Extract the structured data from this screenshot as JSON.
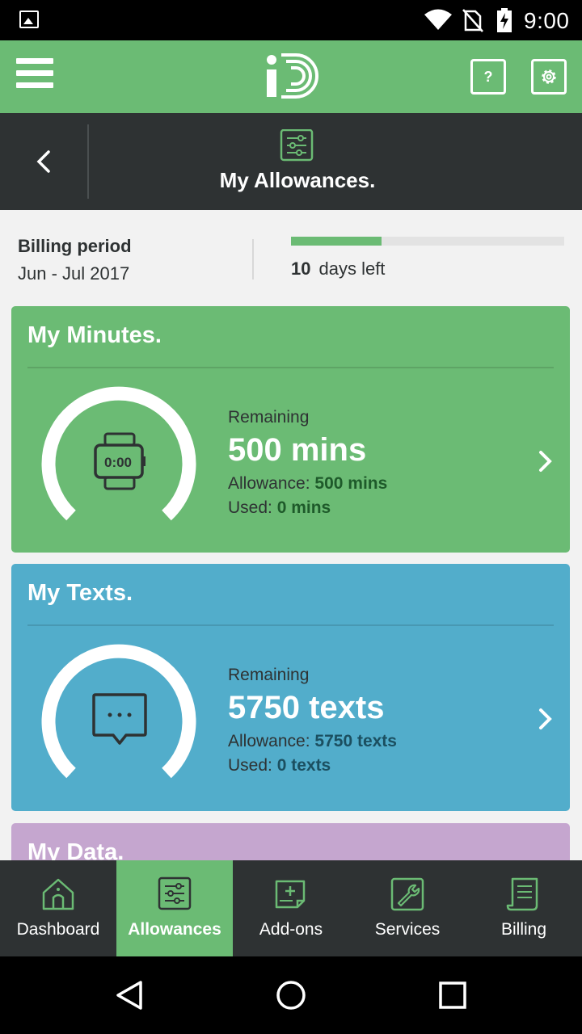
{
  "status_bar": {
    "time": "9:00",
    "icons": [
      "gallery-icon",
      "wifi-icon",
      "no-sim-icon",
      "battery-charging-icon"
    ]
  },
  "app_bar": {
    "menu_icon": "hamburger-menu-icon",
    "logo_icon": "id-logo",
    "help_label": "?",
    "settings_icon": "gear-icon"
  },
  "sub_header": {
    "back_icon": "chevron-left-icon",
    "section_icon": "sliders-icon",
    "title": "My Allowances."
  },
  "billing": {
    "label": "Billing period",
    "period": "Jun - Jul 2017",
    "days_left_number": "10",
    "days_left_text": "days left",
    "elapsed_fraction": 0.33
  },
  "cards": {
    "minutes": {
      "title": "My Minutes.",
      "icon": "watch-icon",
      "watch_display": "0:00",
      "remaining_label": "Remaining",
      "remaining_value": "500 mins",
      "allowance_label": "Allowance:",
      "allowance_value": "500 mins",
      "used_label": "Used:",
      "used_value": "0 mins"
    },
    "texts": {
      "title": "My Texts.",
      "icon": "message-icon",
      "remaining_label": "Remaining",
      "remaining_value": "5750 texts",
      "allowance_label": "Allowance:",
      "allowance_value": "5750 texts",
      "used_label": "Used:",
      "used_value": "0 texts"
    },
    "data": {
      "title": "My Data."
    }
  },
  "bottom_nav": {
    "items": [
      {
        "label": "Dashboard",
        "icon": "house-icon"
      },
      {
        "label": "Allowances",
        "icon": "sliders-icon",
        "active": true
      },
      {
        "label": "Add-ons",
        "icon": "add-doc-icon"
      },
      {
        "label": "Services",
        "icon": "wrench-icon"
      },
      {
        "label": "Billing",
        "icon": "bill-icon"
      }
    ]
  },
  "system_nav": [
    "back-triangle-icon",
    "home-circle-icon",
    "recents-square-icon"
  ],
  "colors": {
    "brand_green": "#6bbb74",
    "texts_blue": "#52adcb",
    "data_purple": "#c5a6cf",
    "dark": "#2e3233"
  }
}
